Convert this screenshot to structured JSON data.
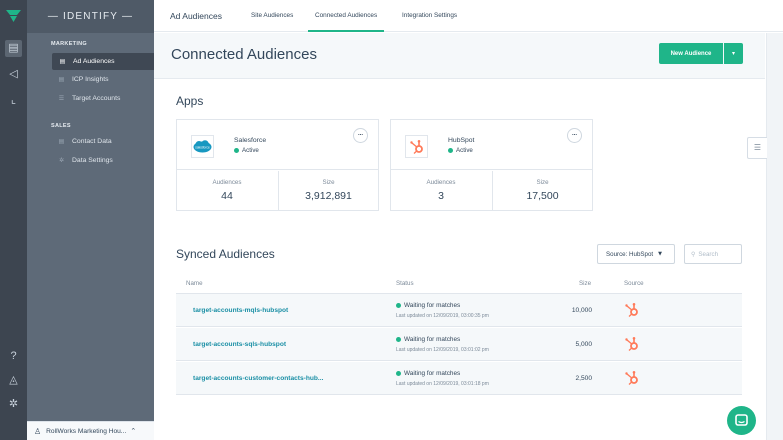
{
  "colors": {
    "accent": "#1fb589",
    "rail": "#3d4550",
    "nav": "#5e6a78",
    "link": "#1a8fa5",
    "hubspot": "#ff7a59",
    "salesforce": "#1798c1"
  },
  "rail": {
    "icons": [
      "logo-icon",
      "grid-icon",
      "megaphone-icon",
      "chart-icon",
      "help-icon",
      "bell-icon",
      "gear-icon"
    ]
  },
  "nav": {
    "brand": "— IDENTIFY —",
    "marketing_label": "MARKETING",
    "marketing_items": [
      {
        "label": "Ad Audiences",
        "icon": "grid-icon",
        "active": true
      },
      {
        "label": "ICP Insights",
        "icon": "grid-icon"
      },
      {
        "label": "Target Accounts",
        "icon": "list-icon"
      }
    ],
    "sales_label": "SALES",
    "sales_items": [
      {
        "label": "Contact Data",
        "icon": "grid-icon"
      },
      {
        "label": "Data Settings",
        "icon": "gear-icon"
      }
    ],
    "account": "RollWorks Marketing Hou..."
  },
  "tabs": [
    "Ad Audiences",
    "Site Audiences",
    "Connected Audiences",
    "Integration Settings"
  ],
  "page": {
    "title": "Connected Audiences",
    "new_button": "New Audience"
  },
  "apps": {
    "heading": "Apps",
    "cards": [
      {
        "name": "Salesforce",
        "status": "Active",
        "audiences_label": "Audiences",
        "audiences": "44",
        "size_label": "Size",
        "size": "3,912,891",
        "logo_text": "salesforce"
      },
      {
        "name": "HubSpot",
        "status": "Active",
        "audiences_label": "Audiences",
        "audiences": "3",
        "size_label": "Size",
        "size": "17,500"
      }
    ]
  },
  "synced": {
    "heading": "Synced Audiences",
    "filter": "Source: HubSpot",
    "search_placeholder": "Search",
    "columns": {
      "name": "Name",
      "status": "Status",
      "size": "Size",
      "source": "Source"
    },
    "rows": [
      {
        "name": "target-accounts-mqls-hubspot",
        "status": "Waiting for matches",
        "updated": "Last updated on 12/09/2019, 03:00:35 pm",
        "size": "10,000"
      },
      {
        "name": "target-accounts-sqls-hubspot",
        "status": "Waiting for matches",
        "updated": "Last updated on 12/09/2019, 03:01:02 pm",
        "size": "5,000"
      },
      {
        "name": "target-accounts-customer-contacts-hub...",
        "status": "Waiting for matches",
        "updated": "Last updated on 12/09/2019, 03:01:18 pm",
        "size": "2,500"
      }
    ]
  }
}
